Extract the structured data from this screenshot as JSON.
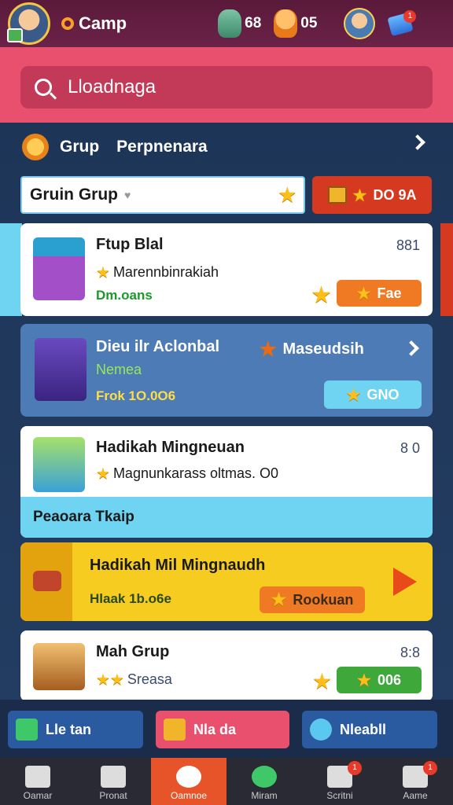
{
  "topbar": {
    "camp_label": "Camp",
    "stat1": "68",
    "stat2": "05",
    "gem_badge": "1"
  },
  "search": {
    "value": "Lloadnaga"
  },
  "section": {
    "title_a": "Grup",
    "title_b": "Perpnenara"
  },
  "filter": {
    "label": "Gruin Grup"
  },
  "offer": {
    "label": "DO 9A"
  },
  "cards": [
    {
      "title": "Ftup Blal",
      "num": "881",
      "sub": "Marennbinrakiah",
      "extra": "Dm.oans",
      "button": "Fae"
    },
    {
      "title": "Dieu ilr Aclonbal",
      "mid": "Maseudsih",
      "sub": "Nemea",
      "extra": "Frok 1O.0O6",
      "button": "GNO"
    },
    {
      "title": "Hadikah Mingneuan",
      "num": "8 0",
      "sub": "Magnunkarass oltmas. O0",
      "band": "Peaoara Tkaip"
    },
    {
      "title": "Hadikah Mil Mingnaudh",
      "extra": "Hlaak 1b.o6e",
      "button": "Rookuan"
    },
    {
      "title": "Mah Grup",
      "num": "8:8",
      "sub": "Sreasa",
      "button": "006"
    }
  ],
  "actions": {
    "a1": "Lle tan",
    "a2": "Nla da",
    "a3": "Nleabll"
  },
  "tabs": [
    {
      "label": "Oamar"
    },
    {
      "label": "Pronat"
    },
    {
      "label": "Oamnoe"
    },
    {
      "label": "Miram"
    },
    {
      "label": "Scritni",
      "badge": "1"
    },
    {
      "label": "Aame",
      "badge": "1"
    }
  ]
}
